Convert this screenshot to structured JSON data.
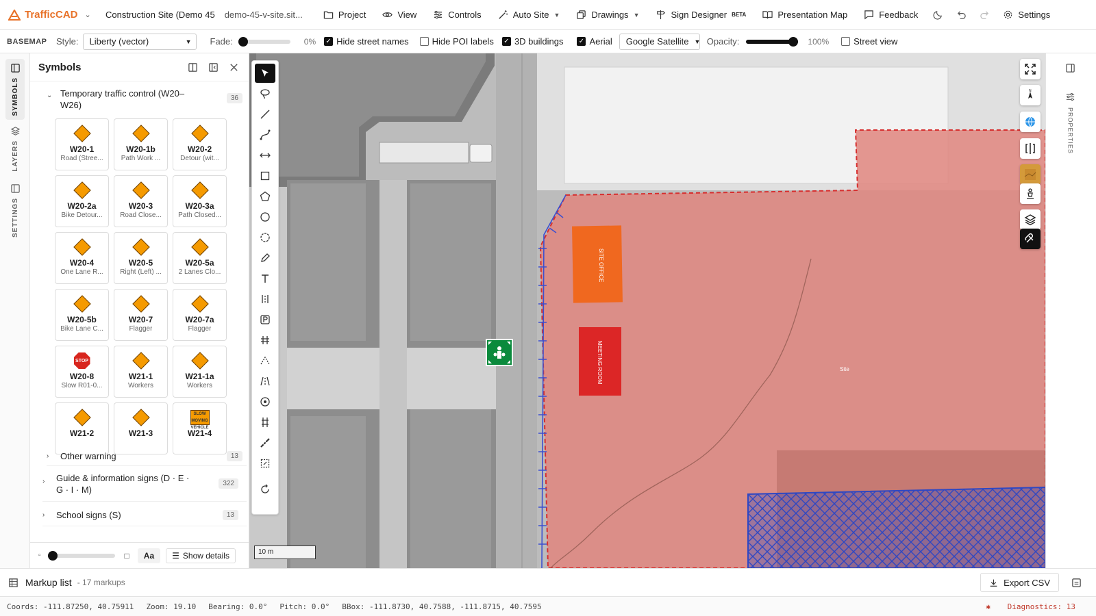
{
  "app": {
    "name": "TrafficCAD",
    "project_title": "Construction Site (Demo 45",
    "project_slug": "demo-45-v-site.sit..."
  },
  "topmenu": {
    "project": "Project",
    "view": "View",
    "controls": "Controls",
    "auto_site": "Auto Site",
    "drawings": "Drawings",
    "sign_designer": "Sign Designer",
    "beta": "BETA",
    "presentation_map": "Presentation Map",
    "feedback": "Feedback",
    "settings": "Settings"
  },
  "basemap": {
    "title": "BASEMAP",
    "style_label": "Style:",
    "style_value": "Liberty (vector)",
    "fade_label": "Fade:",
    "fade_value": "0%",
    "fade_fraction": 0,
    "hide_street_names": "Hide street names",
    "hide_poi_labels": "Hide POI labels",
    "buildings_3d": "3D buildings",
    "aerial": "Aerial",
    "aerial_source": "Google Satellite",
    "opacity_label": "Opacity:",
    "opacity_value": "100%",
    "opacity_fraction": 1,
    "street_view": "Street view"
  },
  "rail": {
    "symbols": "SYMBOLS",
    "layers": "LAYERS",
    "settings": "SETTINGS"
  },
  "panel": {
    "title": "Symbols",
    "category_open": {
      "label_line1": "Temporary traffic control (W20–",
      "label_line2": "W26)",
      "count": "36"
    },
    "signs": [
      {
        "code": "W20-1",
        "desc": "Road (Stree...",
        "shape": "diamond"
      },
      {
        "code": "W20-1b",
        "desc": "Path Work ...",
        "shape": "diamond"
      },
      {
        "code": "W20-2",
        "desc": "Detour (wit...",
        "shape": "diamond"
      },
      {
        "code": "W20-2a",
        "desc": "Bike Detour...",
        "shape": "diamond"
      },
      {
        "code": "W20-3",
        "desc": "Road Close...",
        "shape": "diamond"
      },
      {
        "code": "W20-3a",
        "desc": "Path Closed...",
        "shape": "diamond"
      },
      {
        "code": "W20-4",
        "desc": "One Lane R...",
        "shape": "diamond"
      },
      {
        "code": "W20-5",
        "desc": "Right (Left) ...",
        "shape": "diamond"
      },
      {
        "code": "W20-5a",
        "desc": "2 Lanes Clo...",
        "shape": "diamond"
      },
      {
        "code": "W20-5b",
        "desc": "Bike Lane C...",
        "shape": "diamond"
      },
      {
        "code": "W20-7",
        "desc": "Flagger",
        "shape": "diamond"
      },
      {
        "code": "W20-7a",
        "desc": "Flagger",
        "shape": "diamond"
      },
      {
        "code": "W20-8",
        "desc": "Slow R01-0...",
        "shape": "stop",
        "glyph": "STOP"
      },
      {
        "code": "W21-1",
        "desc": "Workers",
        "shape": "diamond"
      },
      {
        "code": "W21-1a",
        "desc": "Workers",
        "shape": "diamond"
      },
      {
        "code": "W21-2",
        "desc": "",
        "shape": "diamond"
      },
      {
        "code": "W21-3",
        "desc": "",
        "shape": "diamond"
      },
      {
        "code": "W21-4",
        "desc": "",
        "shape": "rect",
        "glyph": "SLOW MOVING VEHICLE"
      }
    ],
    "categories": [
      {
        "label": "Other warning",
        "count": "13"
      },
      {
        "label_line1": "Guide & information signs (D · E ·",
        "label_line2": "G · I · M)",
        "count": "322"
      },
      {
        "label": "School signs (S)",
        "count": "13"
      }
    ],
    "footer": {
      "size_small": "▫",
      "size_large": "□",
      "font_toggle": "Aa",
      "show_details": "Show details",
      "size_fraction": 0
    }
  },
  "map": {
    "scale_label": "10 m",
    "site_office_label": "SITE OFFICE",
    "meeting_room_label": "MEETING ROOM",
    "site_label": "Site",
    "colors": {
      "site_zone": "#e88a86",
      "site_office": "#f0681f",
      "meeting_room": "#dc2626",
      "hatched": "#2f47c2",
      "boundary": "#d62f2f",
      "fence": "#3b4fd0",
      "assembly": "#0a8a3c"
    }
  },
  "properties_label": "PROPERTIES",
  "markup": {
    "title": "Markup list",
    "count": "- 17 markups",
    "export": "Export CSV"
  },
  "status": {
    "coords": "Coords: -111.87250, 40.75911",
    "zoom": "Zoom: 19.10",
    "bearing": "Bearing: 0.0°",
    "pitch": "Pitch: 0.0°",
    "bbox": "BBox: -111.8730, 40.7588, -111.8715, 40.7595",
    "diagnostics": "Diagnostics: 13"
  }
}
